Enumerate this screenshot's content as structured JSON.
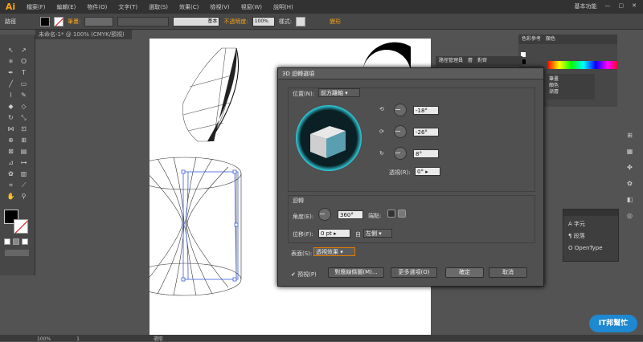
{
  "app": {
    "logo": "Ai"
  },
  "menu": [
    "檔案(F)",
    "編輯(E)",
    "物件(O)",
    "文字(T)",
    "選取(S)",
    "效果(C)",
    "檢視(V)",
    "視窗(W)",
    "說明(H)"
  ],
  "workspace": {
    "label": "基本功能"
  },
  "control": {
    "selection_label": "路徑",
    "stroke_label": "筆畫:",
    "stroke_profile": "基本",
    "opacity_label": "不透明度:",
    "opacity_value": "100%",
    "style_label": "樣式:",
    "transform_label": "變形"
  },
  "document": {
    "tab": "未命名-1* @ 100% (CMYK/預視)"
  },
  "panels": {
    "swatch_tabs": [
      "色彩參考",
      "顏色"
    ],
    "layers_tabs": [
      "路徑管理員",
      "層",
      "對齊"
    ],
    "char_items": [
      "字元",
      "段落",
      "OpenType"
    ],
    "right_items": [
      "筆畫",
      "顏色",
      "漸層"
    ]
  },
  "dialog": {
    "title": "3D 迴轉選項",
    "position_label": "位置(N):",
    "position_value": "前方離軸",
    "rot_x": "-18°",
    "rot_y": "-26°",
    "rot_z": "8°",
    "perspective_label": "透視(R):",
    "perspective_value": "0°",
    "revolve_label": "迴轉",
    "angle_label": "角度(E):",
    "angle_value": "360°",
    "cap_label": "端點:",
    "offset_label": "位移(F):",
    "offset_value": "0 pt",
    "from_label": "自",
    "from_value": "左側",
    "surface_label": "表面(S):",
    "surface_value": "透視效果",
    "preview_label": "預視(P)",
    "map_art_button": "對應線條圖(M)...",
    "more_options_button": "更多選項(O)",
    "ok_button": "確定",
    "cancel_button": "取消"
  },
  "status": {
    "zoom": "100%",
    "page": "1",
    "tool": "選取"
  },
  "watermark": {
    "text": "IT邦幫忙"
  }
}
